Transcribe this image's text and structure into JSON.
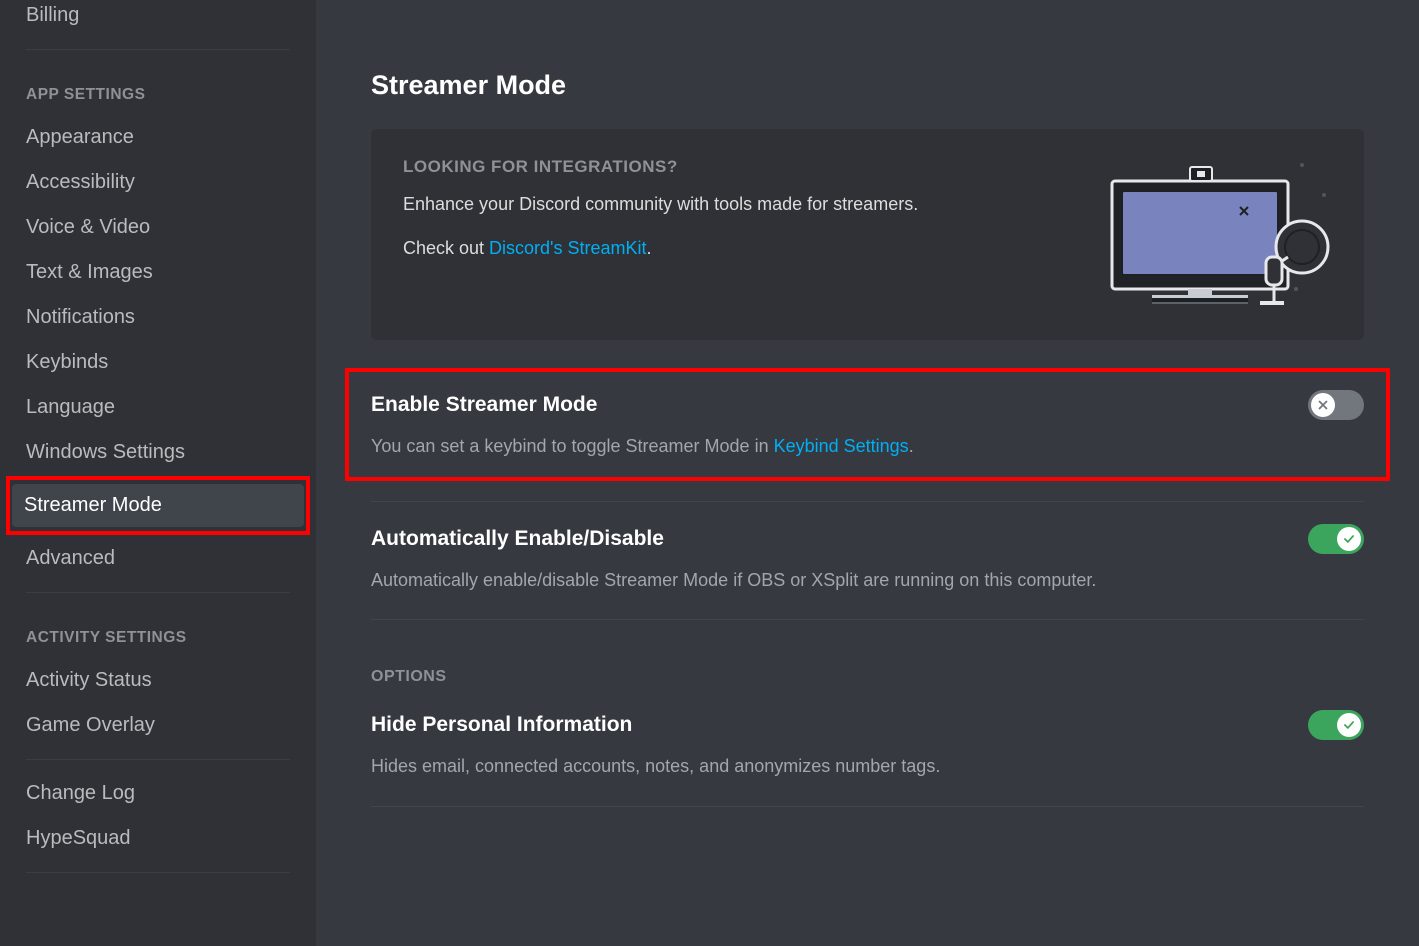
{
  "sidebar": {
    "top_item": "Billing",
    "headers": {
      "app": "APP SETTINGS",
      "activity": "ACTIVITY SETTINGS"
    },
    "app_items": [
      "Appearance",
      "Accessibility",
      "Voice & Video",
      "Text & Images",
      "Notifications",
      "Keybinds",
      "Language",
      "Windows Settings",
      "Streamer Mode",
      "Advanced"
    ],
    "activity_items": [
      "Activity Status",
      "Game Overlay"
    ],
    "bottom_items": [
      "Change Log",
      "HypeSquad"
    ],
    "selected": "Streamer Mode"
  },
  "main": {
    "title": "Streamer Mode",
    "banner": {
      "title": "LOOKING FOR INTEGRATIONS?",
      "line1": "Enhance your Discord community with tools made for streamers.",
      "line2_pre": "Check out ",
      "line2_link": "Discord's StreamKit",
      "line2_post": "."
    },
    "settings": {
      "enable": {
        "title": "Enable Streamer Mode",
        "desc_pre": "You can set a keybind to toggle Streamer Mode in ",
        "desc_link": "Keybind Settings",
        "desc_post": ".",
        "on": false
      },
      "auto": {
        "title": "Automatically Enable/Disable",
        "desc": "Automatically enable/disable Streamer Mode if OBS or XSplit are running on this computer.",
        "on": true
      }
    },
    "options_header": "OPTIONS",
    "options": {
      "hide": {
        "title": "Hide Personal Information",
        "desc": "Hides email, connected accounts, notes, and anonymizes number tags.",
        "on": true
      }
    }
  }
}
